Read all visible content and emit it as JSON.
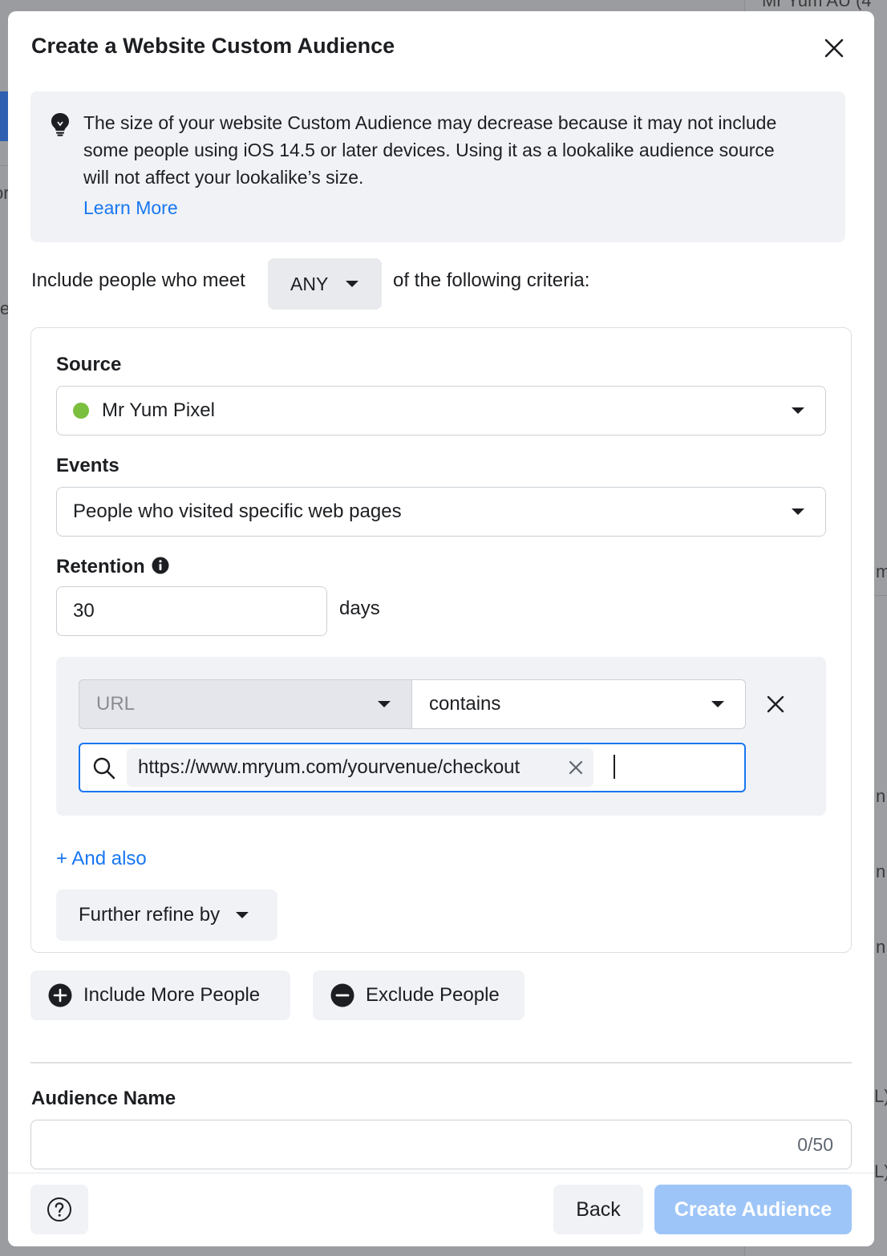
{
  "background": {
    "topright_text": "Mr Yum AU (4",
    "fragments": [
      "or",
      "e",
      "m",
      "n",
      "n",
      "n",
      "L)",
      "L)"
    ]
  },
  "dialog": {
    "title": "Create a Website Custom Audience",
    "close_icon": "close-icon"
  },
  "notice": {
    "icon": "lightbulb-icon",
    "text": "The size of your website Custom Audience may decrease because it may not include some people using iOS 14.5 or later devices. Using it as a lookalike audience source will not affect your lookalike’s size.",
    "link": "Learn More"
  },
  "criteria": {
    "prefix": "Include people who meet",
    "match_value": "ANY",
    "suffix": "of the following criteria:"
  },
  "rule": {
    "source_label": "Source",
    "source_value": "Mr Yum Pixel",
    "source_status_color": "#7bbf3e",
    "events_label": "Events",
    "events_value": "People who visited specific web pages",
    "retention_label": "Retention",
    "retention_info_icon": "info-icon",
    "retention_value": "30",
    "retention_unit": "days",
    "url_field": "URL",
    "operator": "contains",
    "url_token": "https://www.mryum.com/yourvenue/checkout",
    "and_also": "+ And also",
    "refine": "Further refine by"
  },
  "actions": {
    "include_more": "Include More People",
    "exclude": "Exclude People"
  },
  "audience_name": {
    "label": "Audience Name",
    "value": "",
    "counter": "0/50"
  },
  "footer": {
    "help_icon": "help-icon",
    "back": "Back",
    "create": "Create Audience"
  },
  "colors": {
    "accent": "#1877f2",
    "primary_disabled": "#9ec5f8",
    "panel_bg": "#f0f2f5"
  }
}
